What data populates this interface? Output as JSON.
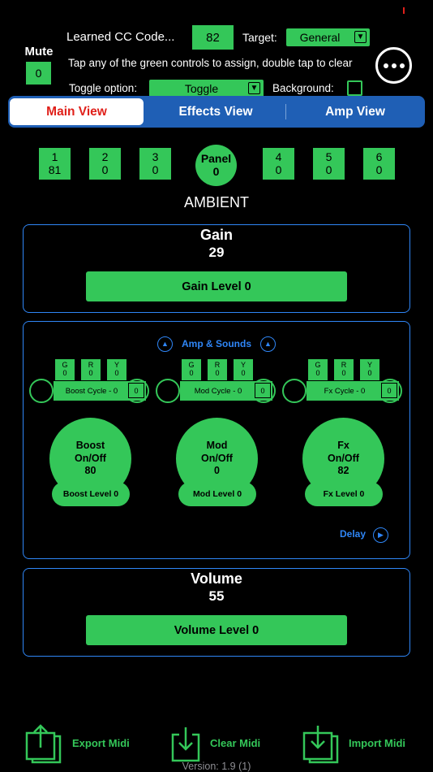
{
  "header": {
    "mute_label": "Mute",
    "mute_value": "0",
    "learned_label": "Learned CC Code...",
    "learned_value": "82",
    "target_label": "Target:",
    "target_value": "General",
    "hint": "Tap any of the green controls to assign, double tap to clear",
    "toggle_label": "Toggle option:",
    "toggle_value": "Toggle",
    "background_label": "Background:"
  },
  "tabs": [
    "Main View",
    "Effects View",
    "Amp View"
  ],
  "presets": [
    {
      "num": "1",
      "val": "81"
    },
    {
      "num": "2",
      "val": "0"
    },
    {
      "num": "3",
      "val": "0"
    },
    {
      "num": "4",
      "val": "0"
    },
    {
      "num": "5",
      "val": "0"
    },
    {
      "num": "6",
      "val": "0"
    }
  ],
  "panel": {
    "label": "Panel",
    "value": "0"
  },
  "patch_name": "AMBIENT",
  "gain": {
    "title": "Gain",
    "value": "29",
    "button": "Gain Level 0"
  },
  "amp_sounds": {
    "title": "Amp & Sounds",
    "units": [
      {
        "g": "G",
        "gv": "0",
        "r": "R",
        "rv": "0",
        "y": "Y",
        "yv": "0",
        "cycle": "Boost Cycle - 0",
        "cycle_val": "0",
        "name": "Boost",
        "onoff": "On/Off",
        "value": "80",
        "level": "Boost Level 0"
      },
      {
        "g": "G",
        "gv": "0",
        "r": "R",
        "rv": "0",
        "y": "Y",
        "yv": "0",
        "cycle": "Mod Cycle - 0",
        "cycle_val": "0",
        "name": "Mod",
        "onoff": "On/Off",
        "value": "0",
        "level": "Mod Level 0"
      },
      {
        "g": "G",
        "gv": "0",
        "r": "R",
        "rv": "0",
        "y": "Y",
        "yv": "0",
        "cycle": "Fx Cycle - 0",
        "cycle_val": "0",
        "name": "Fx",
        "onoff": "On/Off",
        "value": "82",
        "level": "Fx Level 0"
      }
    ],
    "delay_label": "Delay"
  },
  "volume": {
    "title": "Volume",
    "value": "55",
    "button": "Volume Level 0"
  },
  "bottom": {
    "export": "Export Midi",
    "clear": "Clear Midi",
    "import": "Import Midi",
    "version": "Version: 1.9 (1)"
  },
  "colors": {
    "accent_green": "#34c759",
    "accent_blue": "#2f86f6",
    "active_tab_text": "#e0201a",
    "tab_bar": "#1f5fb5"
  },
  "icons": [
    "more-icon",
    "dropdown-arrow-icon",
    "chevron-up-icon",
    "chevron-right-icon",
    "export-icon",
    "clear-icon",
    "import-icon"
  ]
}
